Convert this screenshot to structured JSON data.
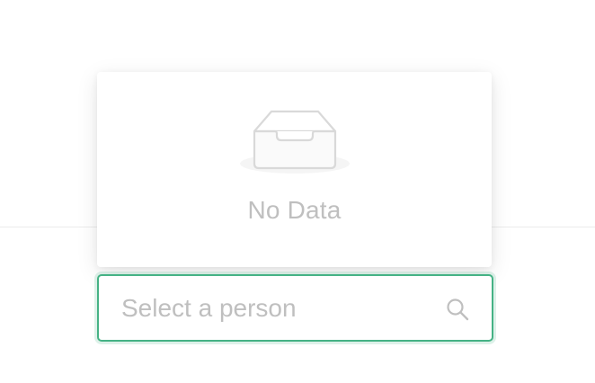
{
  "dropdown": {
    "empty_text": "No Data",
    "empty_icon": "empty-inbox-icon"
  },
  "select": {
    "placeholder": "Select a person",
    "icon": "search-icon",
    "focused": true
  },
  "colors": {
    "accent": "#45b285",
    "muted_text": "#bfbfbf",
    "icon_stroke": "#d9d9d9",
    "icon_fill": "#f5f5f5"
  }
}
